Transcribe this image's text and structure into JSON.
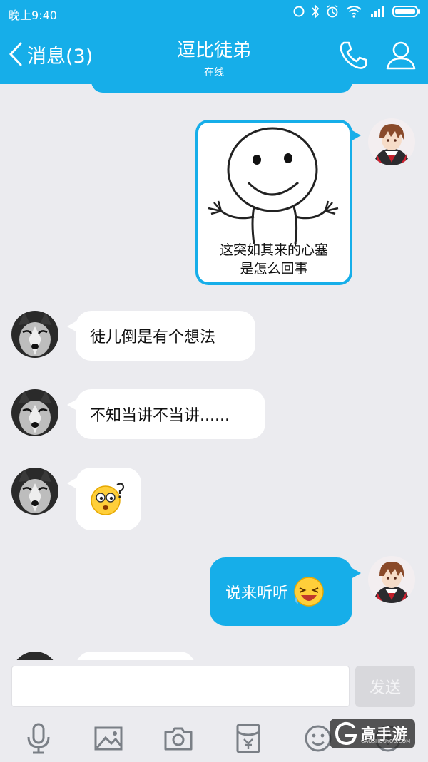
{
  "status": {
    "time": "晚上9:40"
  },
  "header": {
    "back_label": "消息(3)",
    "title": "逗比徒弟",
    "subtitle": "在线"
  },
  "messages": [
    {
      "side": "right",
      "type": "sticker",
      "text": "这突如其来的心塞\n是怎么回事"
    },
    {
      "side": "left",
      "type": "text",
      "text": "徒儿倒是有个想法"
    },
    {
      "side": "left",
      "type": "text",
      "text": "不知当讲不当讲......"
    },
    {
      "side": "left",
      "type": "emoji",
      "icon": "confused-face-emoji"
    },
    {
      "side": "right",
      "type": "text",
      "text": "说来听听"
    }
  ],
  "input": {
    "value": "",
    "send_label": "发送"
  },
  "toolbar": [
    "microphone-icon",
    "image-icon",
    "camera-icon",
    "red-packet-icon",
    "emoji-icon",
    "more-icon"
  ],
  "watermark": {
    "brand": "高手游",
    "sub": "GAOSHOUYOU.COM"
  },
  "colors": {
    "accent": "#16aee9",
    "background": "#ebebef"
  }
}
